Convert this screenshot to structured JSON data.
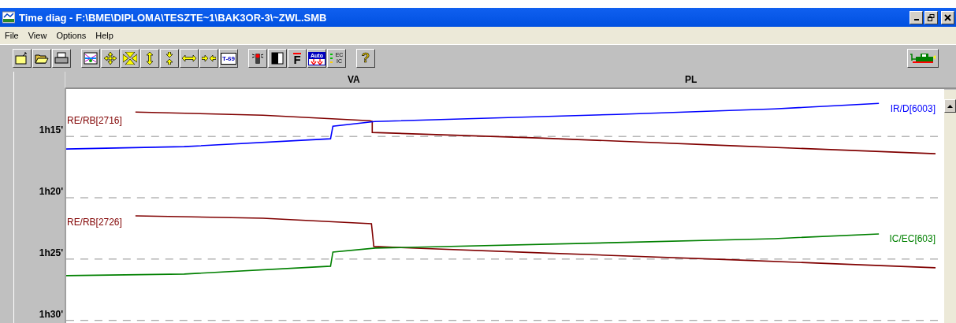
{
  "window": {
    "title": "Time diag - F:\\BME\\DIPLOMA\\TESZTE~1\\BAK3OR-3\\~ZWL.SMB"
  },
  "menu": [
    "File",
    "View",
    "Options",
    "Help"
  ],
  "toolbar": {
    "timetable_label": "T-69",
    "font_label": "F",
    "auto_label": "Auto",
    "filter_labels": [
      "EC",
      "IC"
    ],
    "help_label": "?"
  },
  "stations": [
    "VA",
    "PL"
  ],
  "time_axis": [
    "1h15'",
    "1h20'",
    "1h25'",
    "1h30'"
  ],
  "trains": [
    {
      "label": "RE/RB[2716]",
      "color": "#800000"
    },
    {
      "label": "IR/D[6003]",
      "color": "#0000ff"
    },
    {
      "label": "RE/RB[2726]",
      "color": "#800000"
    },
    {
      "label": "IC/EC[603]",
      "color": "#008000"
    }
  ]
}
